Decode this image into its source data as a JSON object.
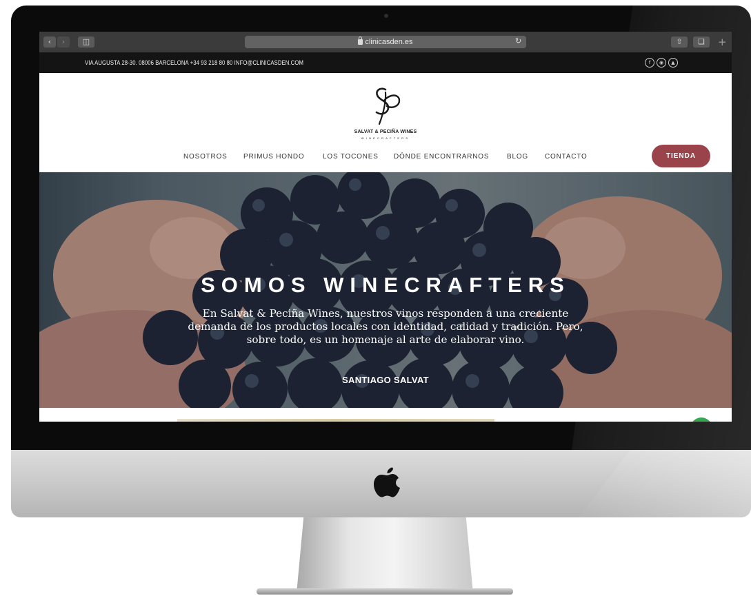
{
  "browser": {
    "url": "clinicasden.es",
    "back_icon": "chevron-left-icon",
    "forward_icon": "chevron-right-icon",
    "sidebar_icon": "sidebar-icon",
    "reload_icon": "reload-icon",
    "share_icon": "share-icon",
    "tabs_icon": "tabs-icon",
    "new_tab_icon": "plus-icon"
  },
  "topbar": {
    "info": "VIA AUGUSTA 28-30. 08006 BARCELONA +34 93 218 80 80 INFO@CLINICASDEN.COM",
    "social": [
      "facebook-icon",
      "instagram-icon",
      "tripadvisor-icon"
    ]
  },
  "header": {
    "logo_monogram": "SP",
    "logo_name": "SALVAT & PECIÑA WINES",
    "logo_tagline": "WINECRAFTERS",
    "nav": [
      {
        "label": "NOSOTROS"
      },
      {
        "label": "PRIMUS HONDO"
      },
      {
        "label": "LOS TOCONES"
      },
      {
        "label": "DÓNDE ENCONTRARNOS"
      },
      {
        "label": "BLOG"
      },
      {
        "label": "CONTACTO"
      }
    ],
    "shop_label": "TIENDA"
  },
  "hero": {
    "title": "SOMOS WINECRAFTERS",
    "quote": "En Salvat & Peciña Wines, nuestros vinos responden a una creciente demanda de los productos locales con identidad, calidad y tradición. Pero, sobre todo, es un homenaje al arte de elaborar vino.",
    "author": "SANTIAGO SALVAT"
  },
  "colors": {
    "shop_button": "#9a434a",
    "topbar": "#141414",
    "browser_chrome": "#3b3b3b"
  }
}
